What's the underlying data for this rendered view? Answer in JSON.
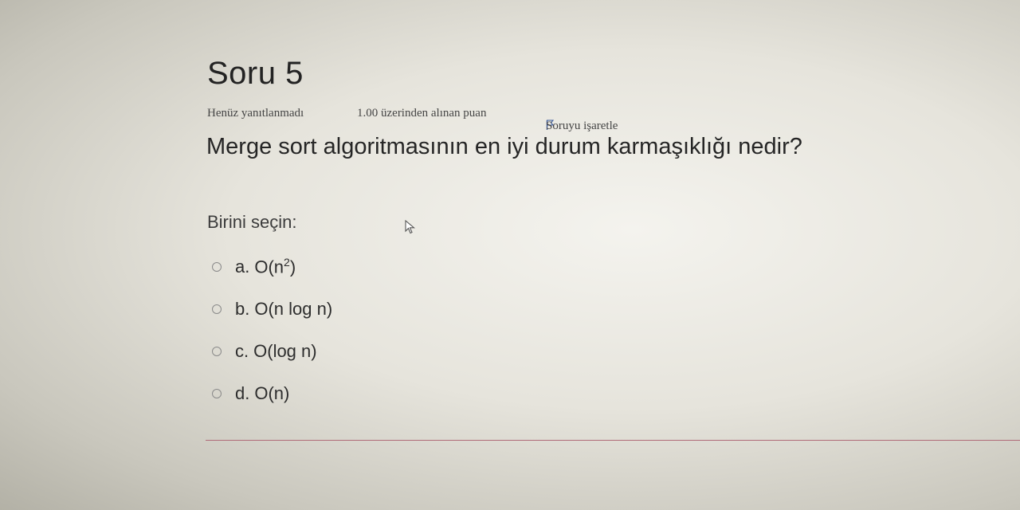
{
  "question": {
    "title": "Soru 5",
    "state": "Henüz yanıtlanmadı",
    "grade": "1.00 üzerinden alınan puan",
    "flag_label": "Soruyu işaretle",
    "text": "Merge sort algoritmasının en iyi durum karmaşıklığı nedir?",
    "prompt": "Birini seçin:",
    "options": [
      {
        "letter": "a.",
        "label_base": "O(n",
        "label_sup": "2",
        "label_end": ")"
      },
      {
        "letter": "b.",
        "label": "O(n log n)"
      },
      {
        "letter": "c.",
        "label": "O(log n)"
      },
      {
        "letter": "d.",
        "label": "O(n)"
      }
    ]
  },
  "icons": {
    "flag": "flag-icon",
    "cursor": "mouse-cursor-icon",
    "radio": "radio-button-icon"
  },
  "colors": {
    "divider": "#b06b78",
    "flag": "#3a5a9a"
  }
}
